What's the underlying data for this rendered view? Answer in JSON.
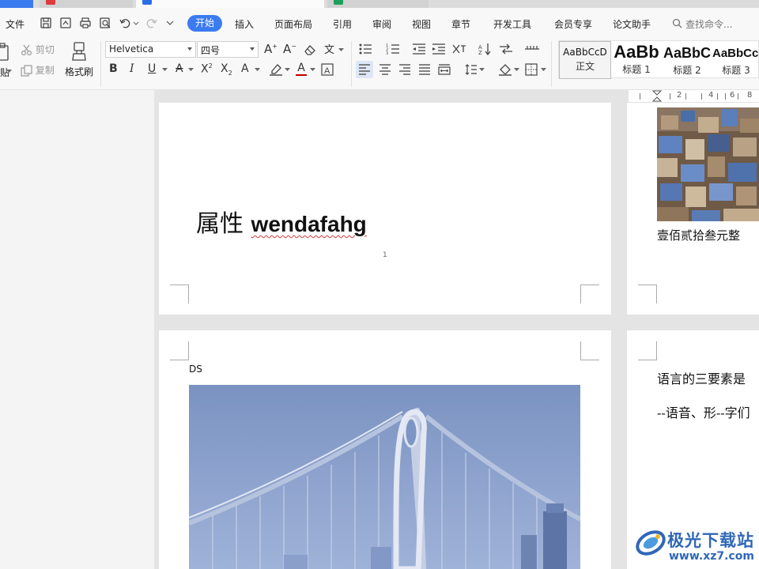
{
  "menubar": {
    "file": "文件",
    "tabs": [
      "开始",
      "插入",
      "页面布局",
      "引用",
      "审阅",
      "视图",
      "章节",
      "开发工具",
      "会员专享",
      "论文助手"
    ],
    "search": "查找命令..."
  },
  "ribbon": {
    "clipboard": {
      "cut": "剪切",
      "copy": "复制",
      "format_painter": "格式刷",
      "paste_fragment": "贴"
    },
    "font": {
      "name": "Helvetica",
      "size": "四号"
    },
    "styles": [
      {
        "sample": "AaBbCcD",
        "name": "正文"
      },
      {
        "sample": "AaBb",
        "name": "标题 1"
      },
      {
        "sample": "AaBbC",
        "name": "标题 2"
      },
      {
        "sample": "AaBbCcI",
        "name": "标题 3"
      }
    ]
  },
  "ruler": {
    "ticks": [
      "2",
      "4",
      "6",
      "8"
    ]
  },
  "document": {
    "page1_title_cn": "属性 ",
    "page1_title_en": "wendafahg",
    "page_number": "1",
    "page2_caption": "壹佰贰拾叁元整",
    "page3_label": "DS",
    "page4_line1": "语言的三要素是",
    "page4_line2": "--语音、形--字们"
  },
  "watermark": {
    "text": "极光下载站",
    "url": "www.xz7.com"
  },
  "colors": {
    "accent": "#3a7bf0",
    "ribbon_bg": "#f8f8f8",
    "workspace": "#e4e4e4",
    "spellcheck": "#d43b3b"
  }
}
